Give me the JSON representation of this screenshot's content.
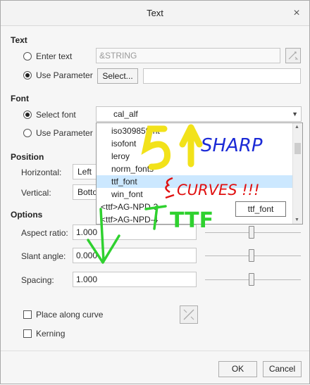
{
  "window": {
    "title": "Text",
    "close_glyph": "×"
  },
  "text_section": {
    "heading": "Text",
    "enter_text_label": "Enter text",
    "enter_text_value": "&STRING",
    "use_parameter_label": "Use Parameter",
    "select_button_label": "Select...",
    "parameter_value": "",
    "selected_option": "Use Parameter"
  },
  "font_section": {
    "heading": "Font",
    "select_font_label": "Select font",
    "use_parameter_label": "Use Parameter",
    "current_font": "cal_alf",
    "selected_option": "Select font",
    "font_list": [
      {
        "label": "iso30985font",
        "selected": false
      },
      {
        "label": "isofont",
        "selected": false
      },
      {
        "label": "leroy",
        "selected": false
      },
      {
        "label": "norm_fonts",
        "selected": false
      },
      {
        "label": "ttf_font",
        "selected": true
      },
      {
        "label": "win_font",
        "selected": false
      },
      {
        "label": "<ttf>AG-NPD-3",
        "selected": false
      },
      {
        "label": "<ttf>AG-NPD-4",
        "selected": false
      }
    ],
    "tooltip": "ttf_font"
  },
  "position_section": {
    "heading": "Position",
    "horizontal_label": "Horizontal:",
    "horizontal_value": "Left",
    "vertical_label": "Vertical:",
    "vertical_value": "Botto"
  },
  "options_section": {
    "heading": "Options",
    "aspect_ratio_label": "Aspect ratio:",
    "aspect_ratio_value": "1.000",
    "slant_angle_label": "Slant angle:",
    "slant_angle_value": "0.000",
    "spacing_label": "Spacing:",
    "spacing_value": "1.000",
    "place_along_curve_label": "Place along curve",
    "place_along_curve_checked": false,
    "kerning_label": "Kerning",
    "kerning_checked": false
  },
  "footer": {
    "ok_label": "OK",
    "cancel_label": "Cancel"
  },
  "annotations": {
    "sharp_text": "SHARP",
    "curves_text": "CURVES !!!",
    "ttf_text": "TTF",
    "colors": {
      "yellow": "#f2e21a",
      "blue": "#1b2ad6",
      "red": "#e01010",
      "green": "#2fd12f"
    }
  },
  "colors": {
    "selection_highlight": "#cce8ff",
    "dialog_bg": "#f6f6f6"
  }
}
